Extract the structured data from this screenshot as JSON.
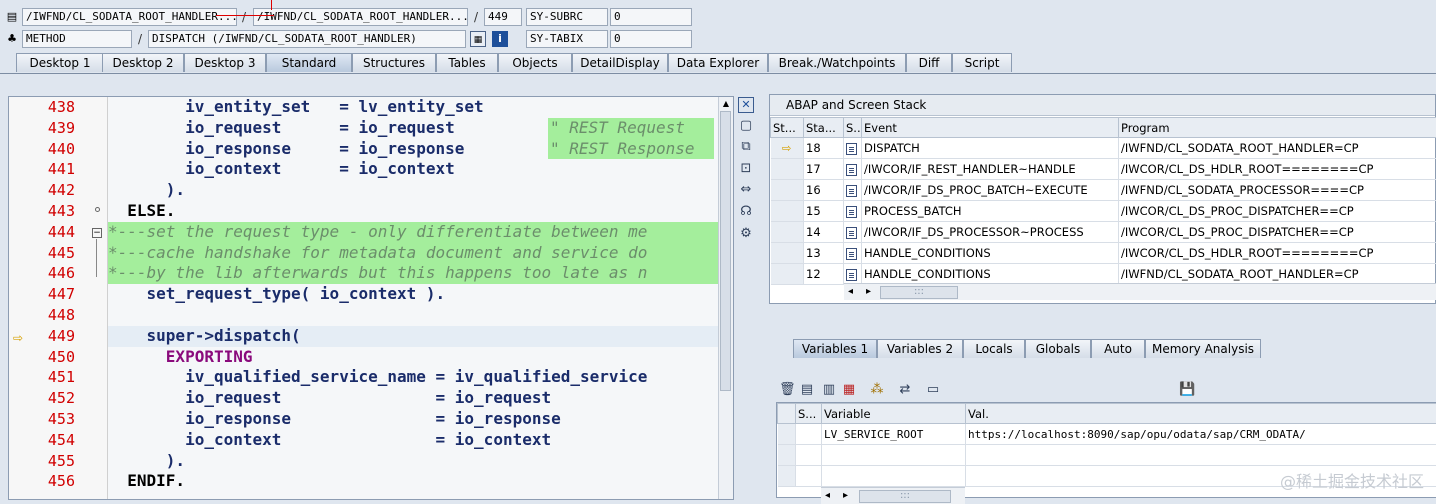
{
  "header": {
    "row1": {
      "include": "/IWFND/CL_SODATA_ROOT_HANDLER...",
      "sep1": "/",
      "program": "/IWFND/CL_SODATA_ROOT_HANDLER...",
      "sep2": "/",
      "line": "449",
      "sysvar": "SY-SUBRC",
      "sysval": "0"
    },
    "row2": {
      "type": "METHOD",
      "sep": "/",
      "event": "DISPATCH (/IWFND/CL_SODATA_ROOT_HANDLER)",
      "sysvar": "SY-TABIX",
      "sysval": "0"
    }
  },
  "tabs": [
    "Desktop 1",
    "Desktop 2",
    "Desktop 3",
    "Standard",
    "Structures",
    "Tables",
    "Objects",
    "DetailDisplay",
    "Data Explorer",
    "Break./Watchpoints",
    "Diff",
    "Script"
  ],
  "active_tab": "Standard",
  "code": {
    "lines": [
      {
        "no": "438",
        "text": "        iv_entity_set   = lv_entity_set"
      },
      {
        "no": "439",
        "text": "        io_request      = io_request",
        "comment": "\" REST Request"
      },
      {
        "no": "440",
        "text": "        io_response     = io_response",
        "comment": "\" REST Response"
      },
      {
        "no": "441",
        "text": "        io_context      = io_context"
      },
      {
        "no": "442",
        "text": "      )."
      },
      {
        "no": "443",
        "text": "  ELSE."
      },
      {
        "no": "444",
        "text": "*---set the request type - only differentiate between me"
      },
      {
        "no": "445",
        "text": "*---cache handshake for metadata document and service do"
      },
      {
        "no": "446",
        "text": "*---by the lib afterwards but this happens too late as n"
      },
      {
        "no": "447",
        "text": "    set_request_type( io_context )."
      },
      {
        "no": "448",
        "text": ""
      },
      {
        "no": "449",
        "text": "    super->dispatch("
      },
      {
        "no": "450",
        "text": "      EXPORTING"
      },
      {
        "no": "451",
        "text": "        iv_qualified_service_name = iv_qualified_service"
      },
      {
        "no": "452",
        "text": "        io_request                = io_request"
      },
      {
        "no": "453",
        "text": "        io_response               = io_response"
      },
      {
        "no": "454",
        "text": "        io_context                = io_context"
      },
      {
        "no": "455",
        "text": "      )."
      },
      {
        "no": "456",
        "text": "  ENDIF."
      }
    ]
  },
  "stack": {
    "title": "ABAP and Screen Stack",
    "columns": [
      "St...",
      "Sta...",
      "S...",
      "Event",
      "Program"
    ],
    "rows": [
      {
        "level": "18",
        "event": "DISPATCH",
        "program": "/IWFND/CL_SODATA_ROOT_HANDLER=CP",
        "current": true
      },
      {
        "level": "17",
        "event": "/IWCOR/IF_REST_HANDLER~HANDLE",
        "program": "/IWCOR/CL_DS_HDLR_ROOT========CP"
      },
      {
        "level": "16",
        "event": "/IWCOR/IF_DS_PROC_BATCH~EXECUTE",
        "program": "/IWFND/CL_SODATA_PROCESSOR====CP"
      },
      {
        "level": "15",
        "event": "PROCESS_BATCH",
        "program": "/IWCOR/CL_DS_PROC_DISPATCHER==CP"
      },
      {
        "level": "14",
        "event": "/IWCOR/IF_DS_PROCESSOR~PROCESS",
        "program": "/IWCOR/CL_DS_PROC_DISPATCHER==CP"
      },
      {
        "level": "13",
        "event": "HANDLE_CONDITIONS",
        "program": "/IWCOR/CL_DS_HDLR_ROOT========CP"
      },
      {
        "level": "12",
        "event": "HANDLE_CONDITIONS",
        "program": "/IWFND/CL_SODATA_ROOT_HANDLER=CP"
      }
    ],
    "scroll_grip": ":::"
  },
  "var_tabs": [
    "Variables 1",
    "Variables 2",
    "Locals",
    "Globals",
    "Auto",
    "Memory Analysis"
  ],
  "active_var_tab": "Variables 1",
  "variables": {
    "columns": [
      "S...",
      "Variable",
      "Val."
    ],
    "rows": [
      {
        "name": "LV_SERVICE_ROOT",
        "value": "https://localhost:8090/sap/opu/odata/sap/CRM_ODATA/"
      }
    ],
    "scroll_grip": ":::"
  },
  "watermark": "@稀土掘金技术社区",
  "colors": {
    "highlight_green": "#a4ee9c",
    "line_numbers": "#d10000",
    "keyword_purple": "#8a0a7c"
  }
}
